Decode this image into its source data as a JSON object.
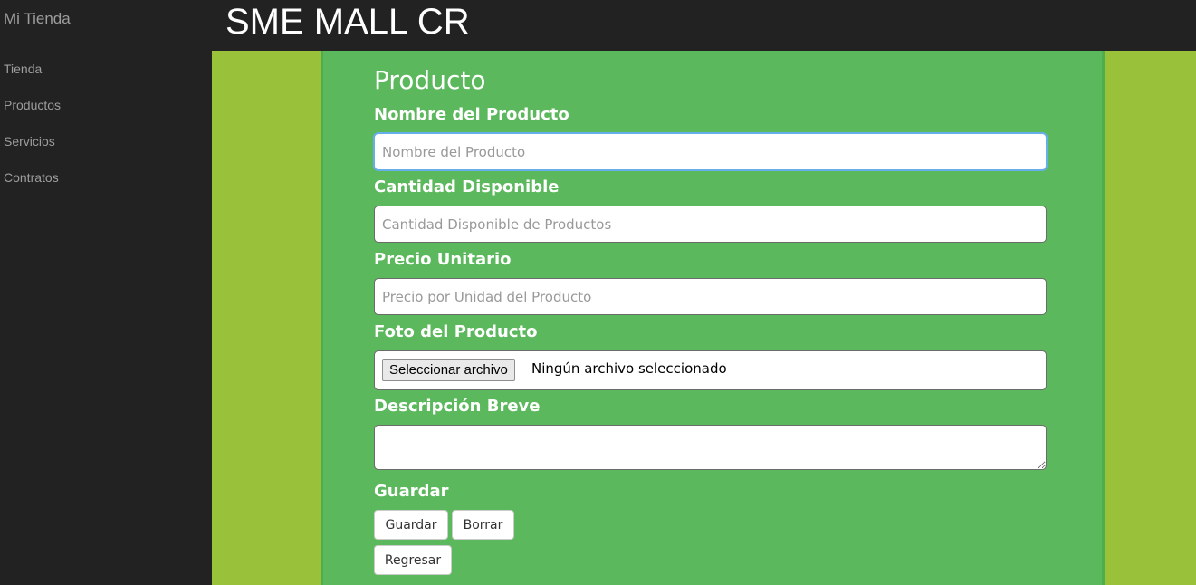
{
  "sidebar": {
    "brand": "Mi Tienda",
    "items": [
      {
        "label": "Tienda"
      },
      {
        "label": "Productos"
      },
      {
        "label": "Servicios"
      },
      {
        "label": "Contratos"
      }
    ]
  },
  "header": {
    "title": "SME MALL CR"
  },
  "form": {
    "title": "Producto",
    "name": {
      "label": "Nombre del Producto",
      "placeholder": "Nombre del Producto",
      "value": ""
    },
    "quantity": {
      "label": "Cantidad Disponible",
      "placeholder": "Cantidad Disponible de Productos",
      "value": ""
    },
    "price": {
      "label": "Precio Unitario",
      "placeholder": "Precio por Unidad del Producto",
      "value": ""
    },
    "photo": {
      "label": "Foto del Producto",
      "button_label": "Seleccionar archivo",
      "status": "Ningún archivo seleccionado"
    },
    "description": {
      "label": "Descripción Breve",
      "value": ""
    },
    "actions_label": "Guardar",
    "save_label": "Guardar",
    "clear_label": "Borrar",
    "back_label": "Regresar"
  },
  "colors": {
    "navbar": "#222222",
    "page_background": "#99c23a",
    "panel_background": "#5cb85c",
    "panel_border": "#4cae4c",
    "input_focus": "#66afe9"
  }
}
